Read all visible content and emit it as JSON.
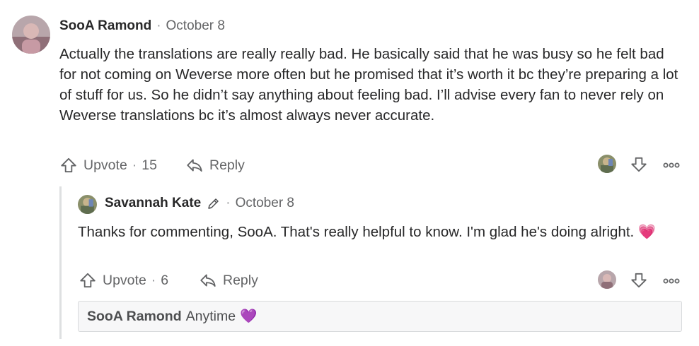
{
  "comment": {
    "author": "SooA Ramond",
    "separator": "·",
    "date": "October 8",
    "text": "Actually the translations are really really bad. He basically said that he was busy so he felt bad for not coming on Weverse more often but he promised that it’s worth it bc they’re preparing a lot of stuff for us. So he didn’t say anything about feeling bad. I’ll advise every fan to never rely on Weverse translations bc it’s almost always never accurate.",
    "upvote_label": "Upvote",
    "upvote_separator": "·",
    "upvote_count": "15",
    "reply_label": "Reply",
    "icons": {
      "upvote": "arrow-up-outline-icon",
      "reply": "reply-arrow-icon",
      "downvote": "arrow-down-outline-icon",
      "more": "more-horizontal-icon"
    }
  },
  "reply": {
    "author": "Savannah Kate",
    "author_badge_icon": "pencil-icon",
    "separator": "·",
    "date": "October 8",
    "text": "Thanks for commenting, SooA. That's really helpful to know. I'm glad he's doing alright.",
    "emoji": "💗",
    "upvote_label": "Upvote",
    "upvote_separator": "·",
    "upvote_count": "6",
    "reply_label": "Reply"
  },
  "nested_reply": {
    "author": "SooA Ramond",
    "text": "Anytime",
    "emoji": "💜"
  },
  "colors": {
    "text": "#282829",
    "muted": "#636466",
    "thread_line": "#dee0e1",
    "nested_bg": "#f7f7f8"
  }
}
